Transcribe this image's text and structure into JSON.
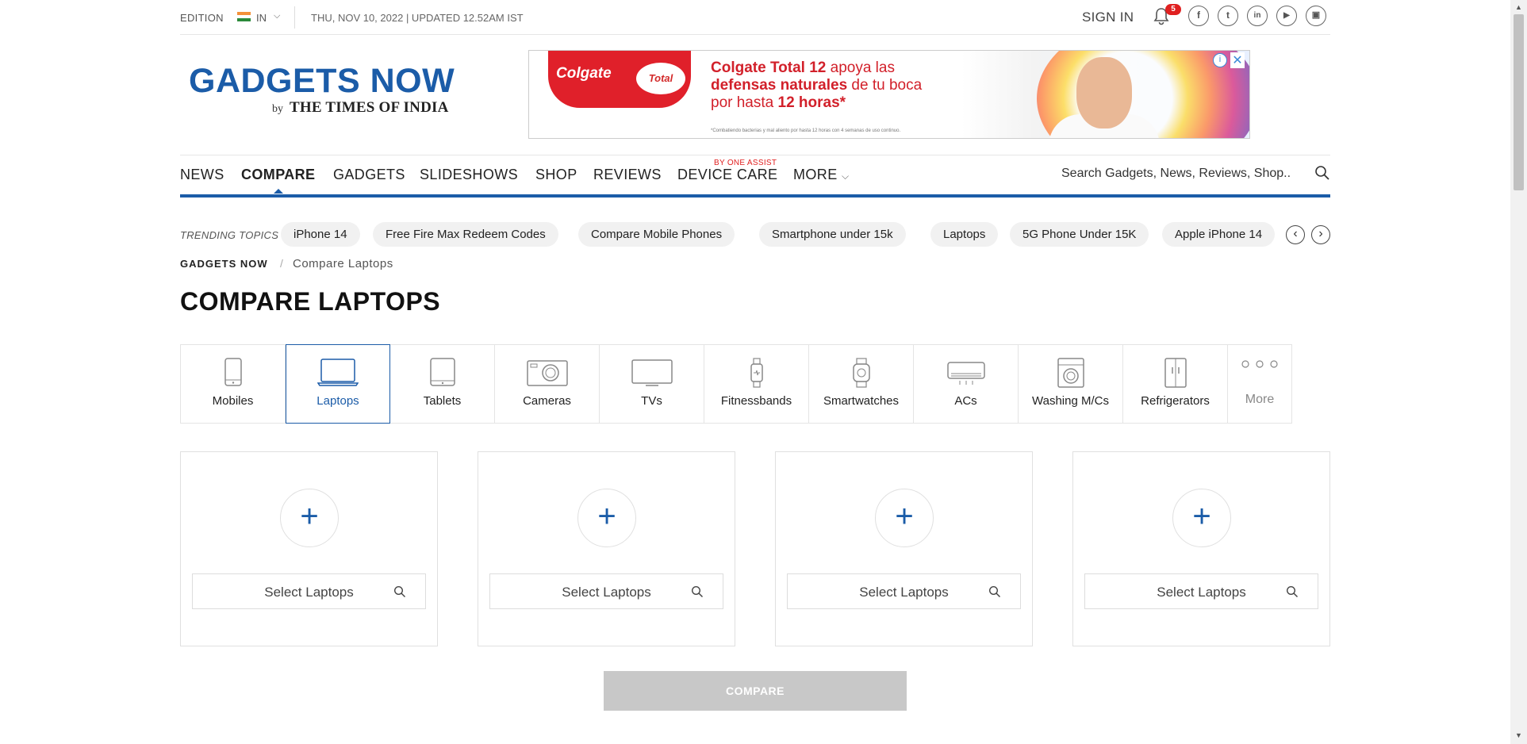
{
  "header": {
    "edition_label": "EDITION",
    "region": "IN",
    "date": "THU, NOV 10, 2022 | UPDATED 12.52AM IST",
    "sign_in": "SIGN IN",
    "notification_count": "5",
    "social_icons": [
      "facebook-icon",
      "twitter-icon",
      "linkedin-icon",
      "youtube-icon",
      "instagram-icon"
    ]
  },
  "logo": {
    "title": "GADGETS NOW",
    "by": "by",
    "publisher": "THE TIMES OF INDIA"
  },
  "ad": {
    "brand": "Colgate",
    "product": "Total",
    "line1": "Colgate Total 12",
    "line1_rest": " apoya las",
    "line2": "defensas naturales",
    "line2_rest": " de tu boca",
    "line3": "por hasta ",
    "line3_bold": "12 horas*",
    "fineprint": "*Combatiendo bacterias y mal aliento por hasta 12 horas con 4 semanas de uso continuo.",
    "info": "i",
    "close": "✕"
  },
  "nav": {
    "items": [
      "NEWS",
      "COMPARE",
      "GADGETS",
      "SLIDESHOWS",
      "SHOP",
      "REVIEWS",
      "DEVICE CARE",
      "MORE"
    ],
    "active": "COMPARE",
    "device_care_tag": "BY ONE ASSIST",
    "search_placeholder": "Search Gadgets, News, Reviews, Shop.."
  },
  "trending": {
    "label": "TRENDING TOPICS",
    "topics": [
      "iPhone 14",
      "Free Fire Max Redeem Codes",
      "Compare Mobile Phones",
      "Smartphone under 15k",
      "Laptops",
      "5G Phone Under 15K",
      "Apple iPhone 14"
    ]
  },
  "breadcrumb": {
    "home": "GADGETS NOW",
    "separator": "/",
    "current": "Compare Laptops"
  },
  "page_title": "COMPARE LAPTOPS",
  "categories": [
    {
      "label": "Mobiles",
      "icon": "mobile-icon"
    },
    {
      "label": "Laptops",
      "icon": "laptop-icon",
      "active": true
    },
    {
      "label": "Tablets",
      "icon": "tablet-icon"
    },
    {
      "label": "Cameras",
      "icon": "camera-icon"
    },
    {
      "label": "TVs",
      "icon": "tv-icon"
    },
    {
      "label": "Fitnessbands",
      "icon": "fitnessband-icon"
    },
    {
      "label": "Smartwatches",
      "icon": "smartwatch-icon"
    },
    {
      "label": "ACs",
      "icon": "ac-icon"
    },
    {
      "label": "Washing M/Cs",
      "icon": "washing-machine-icon"
    },
    {
      "label": "Refrigerators",
      "icon": "refrigerator-icon"
    },
    {
      "label": "More",
      "icon": "more-dots-icon"
    }
  ],
  "slots": [
    {
      "plus": "+",
      "placeholder": "Select Laptops"
    },
    {
      "plus": "+",
      "placeholder": "Select Laptops"
    },
    {
      "plus": "+",
      "placeholder": "Select Laptops"
    },
    {
      "plus": "+",
      "placeholder": "Select Laptops"
    }
  ],
  "compare_button": "COMPARE",
  "colors": {
    "brand_blue": "#1b5ca8",
    "badge_red": "#e02020",
    "disabled_button": "#c8c8c8"
  }
}
